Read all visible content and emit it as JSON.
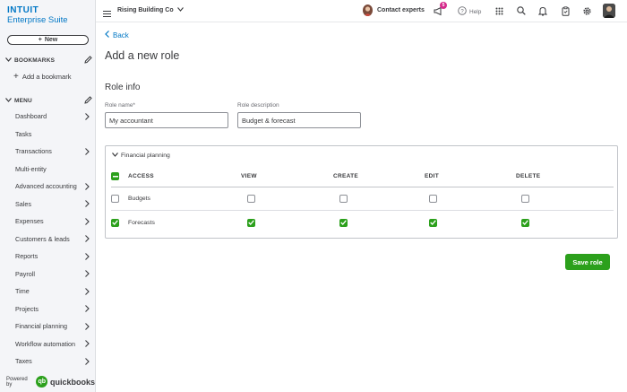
{
  "brand": {
    "top": "INTUIT",
    "sub": "Enterprise Suite"
  },
  "sidebar": {
    "new_label": "New",
    "bookmarks_label": "BOOKMARKS",
    "add_bookmark": "Add a bookmark",
    "menu_label": "MENU",
    "items": [
      {
        "label": "Dashboard",
        "arrow": true
      },
      {
        "label": "Tasks",
        "arrow": false
      },
      {
        "label": "Transactions",
        "arrow": true
      },
      {
        "label": "Multi-entity",
        "arrow": false
      },
      {
        "label": "Advanced accounting",
        "arrow": true
      },
      {
        "label": "Sales",
        "arrow": true
      },
      {
        "label": "Expenses",
        "arrow": true
      },
      {
        "label": "Customers & leads",
        "arrow": true
      },
      {
        "label": "Reports",
        "arrow": true
      },
      {
        "label": "Payroll",
        "arrow": true
      },
      {
        "label": "Time",
        "arrow": true
      },
      {
        "label": "Projects",
        "arrow": true
      },
      {
        "label": "Financial planning",
        "arrow": true
      },
      {
        "label": "Workflow automation",
        "arrow": true
      },
      {
        "label": "Taxes",
        "arrow": true
      }
    ],
    "powered_by": "Powered by",
    "qb_word": "quickbooks"
  },
  "topbar": {
    "company": "Rising Building Co",
    "contact": "Contact experts",
    "notif_count": "5",
    "help": "Help"
  },
  "main": {
    "back": "Back",
    "title": "Add a new role",
    "section": "Role info",
    "role_name_label": "Role name*",
    "role_name_value": "My accountant",
    "role_desc_label": "Role description",
    "role_desc_value": "Budget & forecast",
    "group_name": "Financial planning",
    "columns": [
      "ACCESS",
      "VIEW",
      "CREATE",
      "EDIT",
      "DELETE"
    ],
    "rows": [
      {
        "name": "Budgets",
        "checked": false,
        "perms": [
          false,
          false,
          false,
          false
        ]
      },
      {
        "name": "Forecasts",
        "checked": true,
        "perms": [
          true,
          true,
          true,
          true
        ]
      }
    ],
    "save": "Save role"
  },
  "colors": {
    "brand_blue": "#0077c5",
    "green": "#2ca01c",
    "badge": "#d52b8c"
  }
}
